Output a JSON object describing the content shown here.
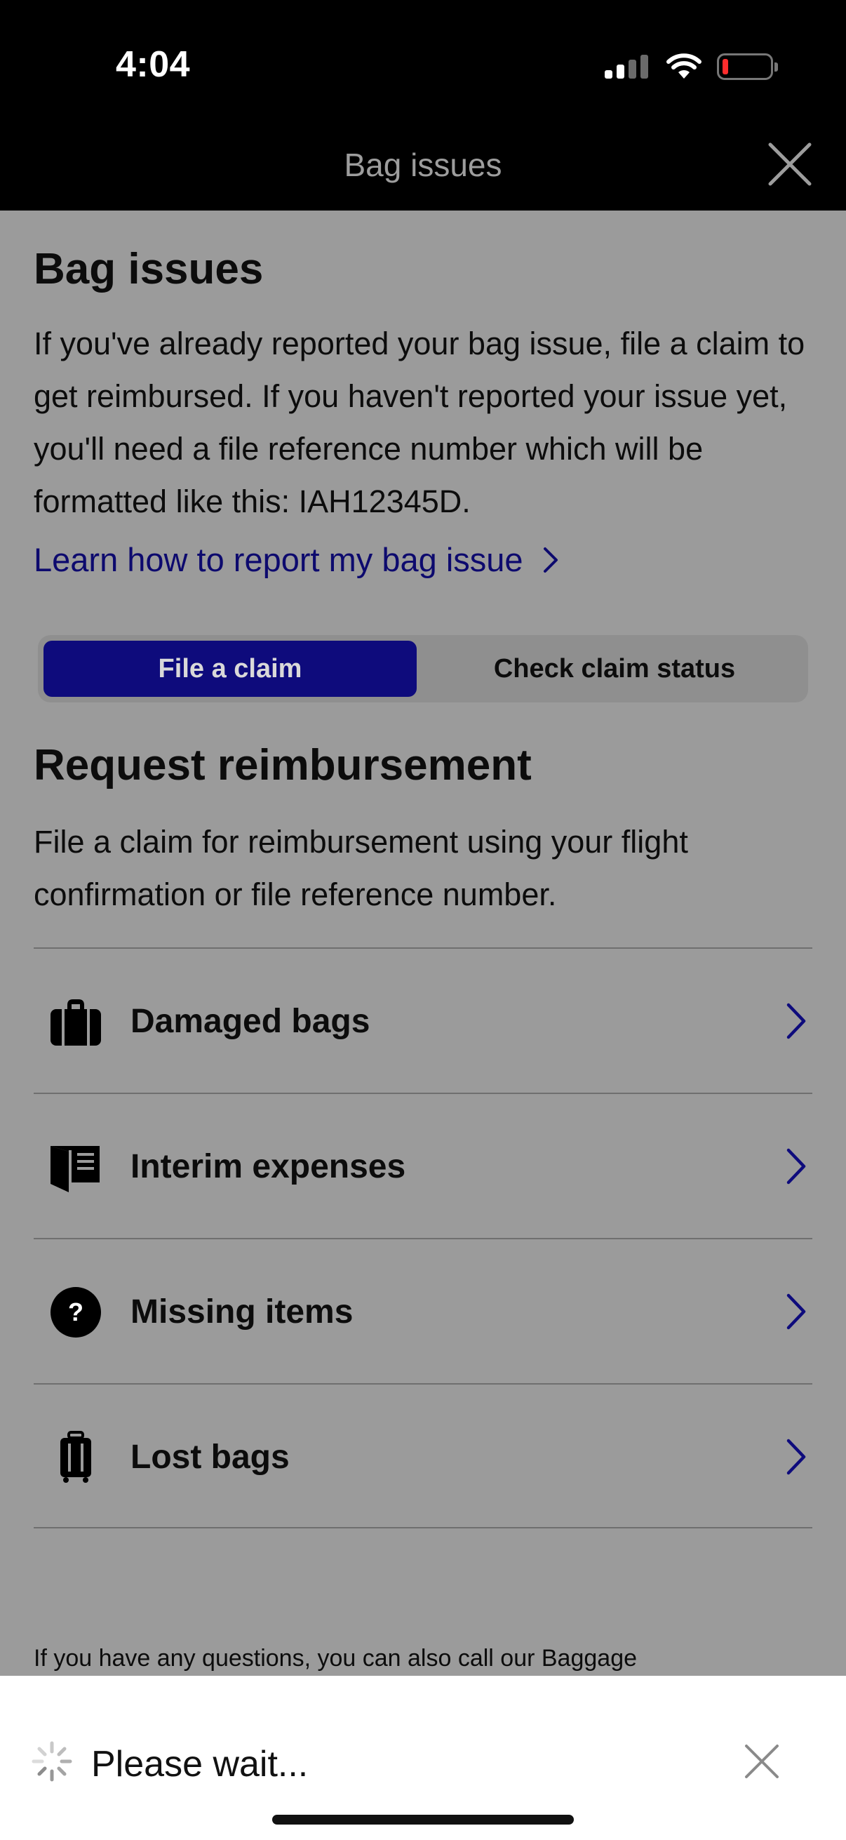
{
  "status_bar": {
    "time": "4:04"
  },
  "header": {
    "title": "Bag issues"
  },
  "section": {
    "title": "Bag issues",
    "intro": "If you've already reported your bag issue, file a claim to get reimbursed. If you haven't reported your issue yet, you'll need a file reference number which will be formatted like this: IAH12345D.",
    "learn_link": "Learn how to report my bag issue"
  },
  "tabs": [
    {
      "label": "File a claim",
      "active": true
    },
    {
      "label": "Check claim status",
      "active": false
    }
  ],
  "reimbursement": {
    "title": "Request reimbursement",
    "subtitle": "File a claim for reimbursement using your flight confirmation or file reference number."
  },
  "claim_types": [
    {
      "label": "Damaged bags",
      "icon": "briefcase-icon"
    },
    {
      "label": "Interim expenses",
      "icon": "receipt-icon"
    },
    {
      "label": "Missing items",
      "icon": "question-circle-icon"
    },
    {
      "label": "Lost bags",
      "icon": "luggage-icon"
    }
  ],
  "footer_note": "If you have any questions, you can also call our Baggage",
  "toast": {
    "message": "Please wait..."
  },
  "colors": {
    "accent": "#0e0b7c",
    "link": "#0d0a6e",
    "overlay_bg": "#9b9b9b",
    "header_bg": "#000000"
  }
}
